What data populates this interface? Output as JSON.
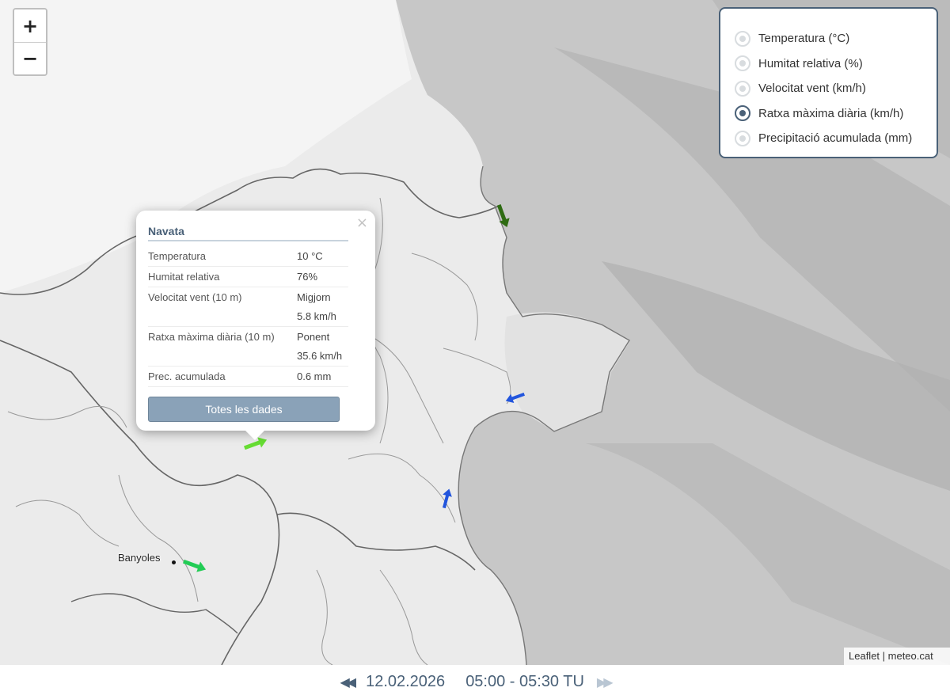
{
  "map": {
    "zoom_in_label": "+",
    "zoom_out_label": "−",
    "city_label": "Banyoles",
    "attribution": "Leaflet | meteo.cat",
    "sea_color": "#c8c8c8",
    "land_color": "#ececec",
    "arrow_colors": {
      "dark_green": "#2e6b12",
      "light_green": "#66dd33",
      "green": "#22cc55",
      "blue": "#2255dd"
    }
  },
  "layers": {
    "items": [
      {
        "label": "Temperatura (°C)",
        "selected": false
      },
      {
        "label": "Humitat relativa (%)",
        "selected": false
      },
      {
        "label": "Velocitat vent (km/h)",
        "selected": false
      },
      {
        "label": "Ratxa màxima diària (km/h)",
        "selected": true
      },
      {
        "label": "Precipitació acumulada (mm)",
        "selected": false
      }
    ]
  },
  "popup": {
    "close_label": "×",
    "station": "Navata",
    "rows": [
      {
        "key": "Temperatura",
        "value": "10 °C"
      },
      {
        "key": "Humitat relativa",
        "value": "76%"
      },
      {
        "key": "Velocitat vent (10 m)",
        "value": "Migjorn",
        "value2": "5.8 km/h"
      },
      {
        "key": "Ratxa màxima diària (10 m)",
        "value": "Ponent",
        "value2": "35.6 km/h"
      },
      {
        "key": "Prec. acumulada",
        "value": "0.6 mm"
      }
    ],
    "button_label": "Totes les dades"
  },
  "timebar": {
    "prev_label": "◀◀",
    "next_label": "▶▶",
    "date": "12.02.2026",
    "time": "05:00 - 05:30 TU"
  }
}
